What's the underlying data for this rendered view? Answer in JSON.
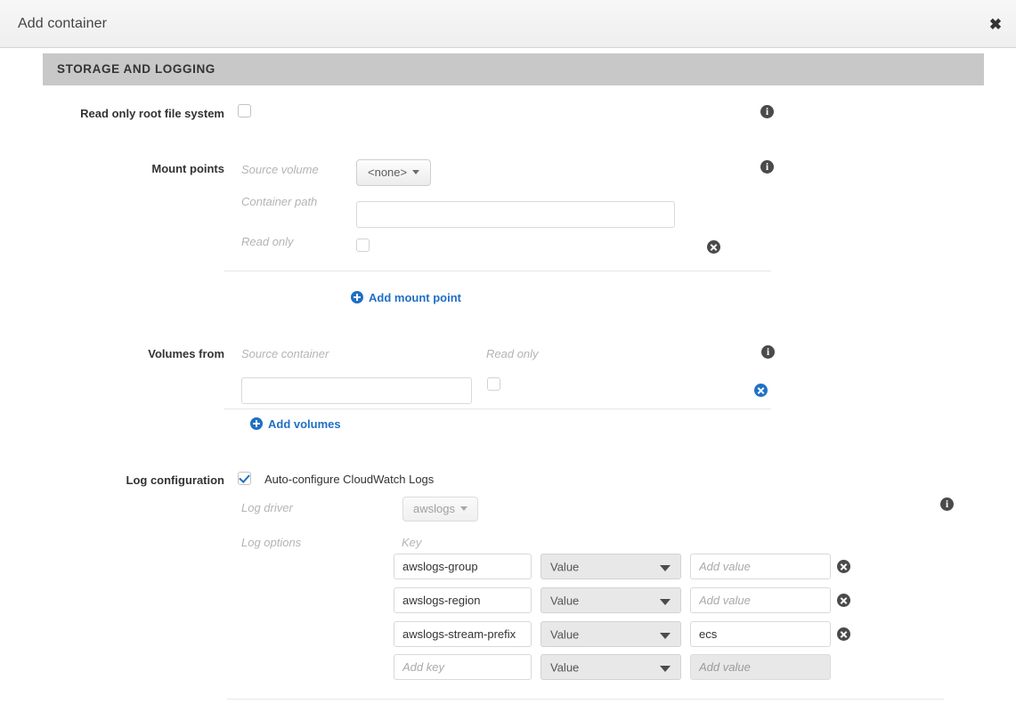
{
  "dialog": {
    "title": "Add container",
    "close_icon": "close-icon"
  },
  "section": {
    "title": "STORAGE AND LOGGING"
  },
  "read_only_root": {
    "label": "Read only root file system",
    "checked": false,
    "info_icon": "info-icon"
  },
  "mount_points": {
    "label": "Mount points",
    "info_icon": "info-icon",
    "rows": [
      {
        "source_volume_label": "Source volume",
        "source_volume_value": "<none>",
        "container_path_label": "Container path",
        "container_path_value": "",
        "container_path_placeholder": "",
        "read_only_label": "Read only",
        "read_only_checked": false,
        "remove_icon": "remove-icon"
      }
    ],
    "add_label": "Add mount point"
  },
  "volumes_from": {
    "label": "Volumes from",
    "info_icon": "info-icon",
    "source_container_label": "Source container",
    "read_only_label": "Read only",
    "rows": [
      {
        "source_container_value": "",
        "source_container_placeholder": "",
        "read_only_checked": false,
        "remove_icon": "remove-icon"
      }
    ],
    "add_label": "Add volumes"
  },
  "log_configuration": {
    "label": "Log configuration",
    "auto_configure_label": "Auto-configure CloudWatch Logs",
    "auto_configure_checked": true,
    "info_icon": "info-icon",
    "log_driver_label": "Log driver",
    "log_driver_value": "awslogs",
    "log_options_label": "Log options",
    "key_column_label": "Key",
    "rows": [
      {
        "key": "awslogs-group",
        "key_placeholder": "",
        "type": "Value",
        "value": "",
        "value_placeholder": "Add value",
        "value_disabled": false,
        "removable": true
      },
      {
        "key": "awslogs-region",
        "key_placeholder": "",
        "type": "Value",
        "value": "",
        "value_placeholder": "Add value",
        "value_disabled": false,
        "removable": true
      },
      {
        "key": "awslogs-stream-prefix",
        "key_placeholder": "",
        "type": "Value",
        "value": "ecs",
        "value_placeholder": "Add value",
        "value_disabled": false,
        "removable": true
      },
      {
        "key": "",
        "key_placeholder": "Add key",
        "type": "Value",
        "value": "",
        "value_placeholder": "Add value",
        "value_disabled": true,
        "removable": false
      }
    ]
  },
  "colors": {
    "accent_blue": "#1f6fc4",
    "section_header_bg": "#c8c8c8",
    "muted_label": "#b4b4b4"
  }
}
